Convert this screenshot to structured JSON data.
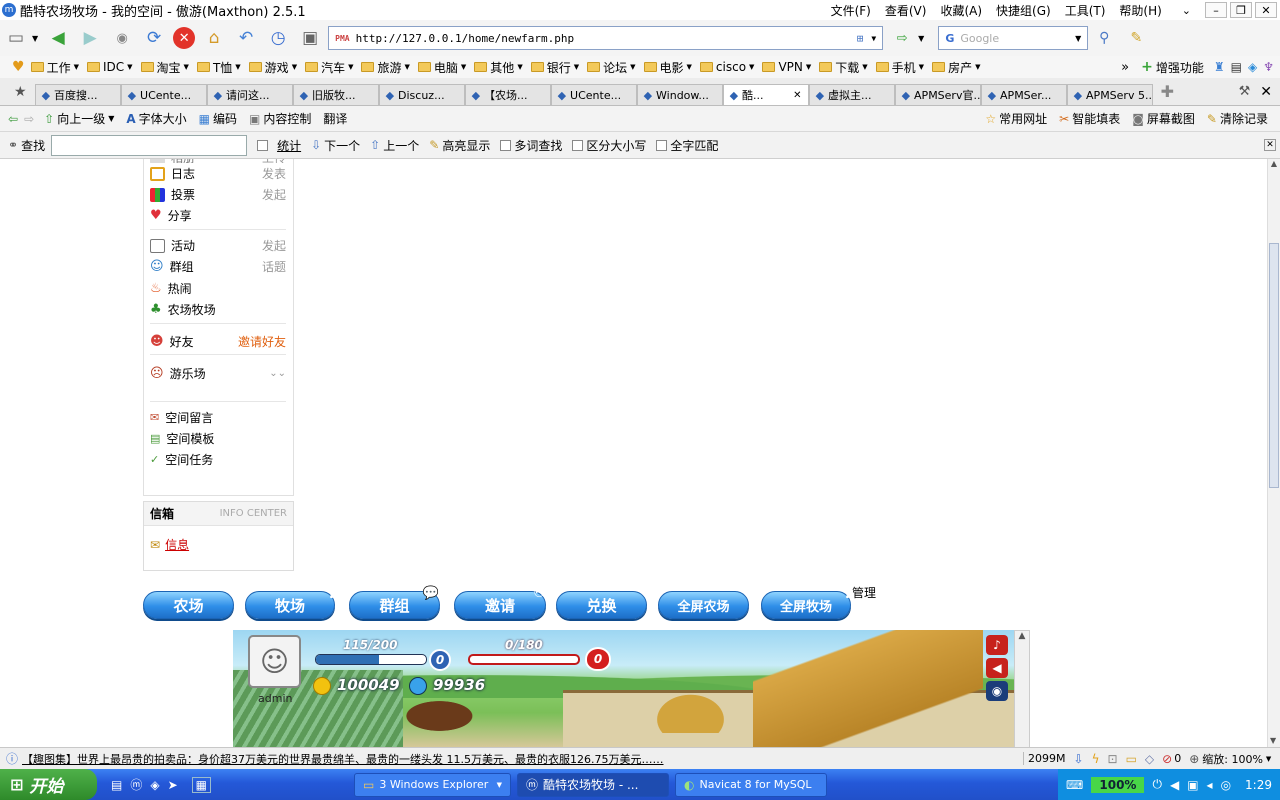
{
  "window": {
    "title": "酷特农场牧场 - 我的空间 - 傲游(Maxthon) 2.5.1",
    "menu": [
      "文件(F)",
      "查看(V)",
      "收藏(A)",
      "快捷组(G)",
      "工具(T)",
      "帮助(H)"
    ]
  },
  "toolbar": {
    "address": "http://127.0.0.1/home/newfarm.php",
    "search_placeholder": "Google"
  },
  "favorites": [
    "工作",
    "IDC",
    "淘宝",
    "T恤",
    "游戏",
    "汽车",
    "旅游",
    "电脑",
    "其他",
    "银行",
    "论坛",
    "电影",
    "cisco",
    "VPN",
    "下载",
    "手机",
    "房产"
  ],
  "favorites_right": "增强功能",
  "tabs": [
    {
      "label": "百度搜...",
      "active": false
    },
    {
      "label": "UCente...",
      "active": false
    },
    {
      "label": "请问这...",
      "active": false
    },
    {
      "label": "旧版牧...",
      "active": false
    },
    {
      "label": "Discuz...",
      "active": false
    },
    {
      "label": "【农场...",
      "active": false
    },
    {
      "label": "UCente...",
      "active": false
    },
    {
      "label": "Window...",
      "active": false
    },
    {
      "label": "酷...",
      "active": true
    },
    {
      "label": "虚拟主...",
      "active": false
    },
    {
      "label": "APMServ官...",
      "active": false
    },
    {
      "label": "APMSer...",
      "active": false
    },
    {
      "label": "APMServ 5...",
      "active": false
    }
  ],
  "navbar": {
    "left": [
      "向上一级",
      "字体大小",
      "编码",
      "内容控制",
      "翻译"
    ],
    "right": [
      "常用网址",
      "智能填表",
      "屏幕截图",
      "清除记录"
    ]
  },
  "findbar": {
    "label": "查找",
    "stats": "统计",
    "next": "下一个",
    "prev": "上一个",
    "highlight": "高亮显示",
    "multi": "多词查找",
    "case": "区分大小写",
    "whole": "全字匹配"
  },
  "sidebar": {
    "top_partial": {
      "label": "相册",
      "action": "上传"
    },
    "items": [
      {
        "label": "日志",
        "action": "发表"
      },
      {
        "label": "投票",
        "action": "发起"
      },
      {
        "label": "分享",
        "action": ""
      },
      {
        "label": "活动",
        "action": "发起"
      },
      {
        "label": "群组",
        "action": "话题"
      },
      {
        "label": "热闹",
        "action": ""
      },
      {
        "label": "农场牧场",
        "action": ""
      },
      {
        "label": "好友",
        "action": "邀请好友"
      },
      {
        "label": "游乐场",
        "action": ""
      },
      {
        "label": "空间留言",
        "action": ""
      },
      {
        "label": "空间模板",
        "action": ""
      },
      {
        "label": "空间任务",
        "action": ""
      }
    ]
  },
  "infobox": {
    "title": "信箱",
    "subtitle": "INFO CENTER",
    "link": "信息"
  },
  "game_buttons": [
    "农场",
    "牧场",
    "群组",
    "邀请",
    "兑换",
    "全屏农场",
    "全屏牧场"
  ],
  "manage_label": "管理",
  "game": {
    "player": "admin",
    "exp": "115/200",
    "level": "0",
    "exp_fraction": 0.575,
    "hp": "0/180",
    "heart_level": "0",
    "hp_fraction": 0.0,
    "gold": "100049",
    "coupons": "99936"
  },
  "status": {
    "ticker": "【趣图集】世界上最昂贵的拍卖品：身价超37万美元的世界最贵绵羊、最贵的一缕头发 11.5万美元、最贵的衣服126.75万美元……",
    "memory": "2099M",
    "count": "0",
    "zoom": "缩放: 100%"
  },
  "taskbar": {
    "start": "开始",
    "windows": [
      "3 Windows Explorer",
      "酷特农场牧场 - ...",
      "Navicat 8 for MySQL"
    ],
    "battery": "100%",
    "clock": "1:29"
  }
}
